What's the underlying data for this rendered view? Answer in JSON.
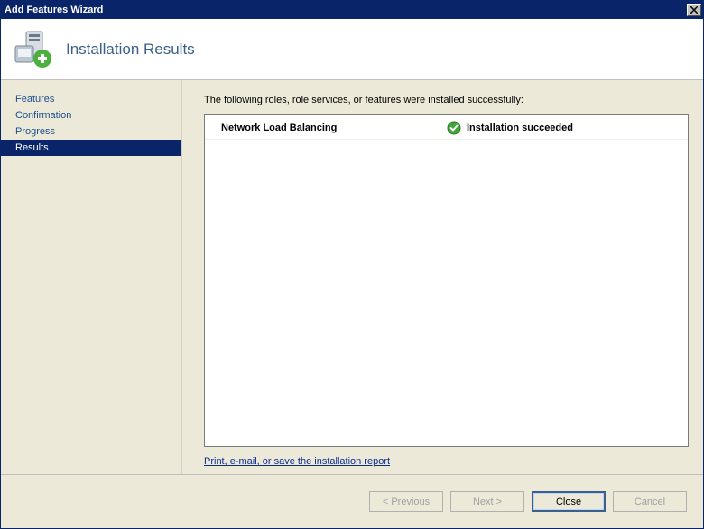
{
  "window": {
    "title": "Add Features Wizard"
  },
  "header": {
    "title": "Installation Results"
  },
  "sidebar": {
    "items": [
      {
        "label": "Features"
      },
      {
        "label": "Confirmation"
      },
      {
        "label": "Progress"
      },
      {
        "label": "Results"
      }
    ]
  },
  "content": {
    "intro": "The following roles, role services, or features were installed successfully:",
    "result": {
      "feature": "Network Load Balancing",
      "status": "Installation succeeded"
    },
    "report_link": "Print, e-mail, or save the installation report"
  },
  "footer": {
    "previous": "< Previous",
    "next": "Next >",
    "close": "Close",
    "cancel": "Cancel"
  }
}
